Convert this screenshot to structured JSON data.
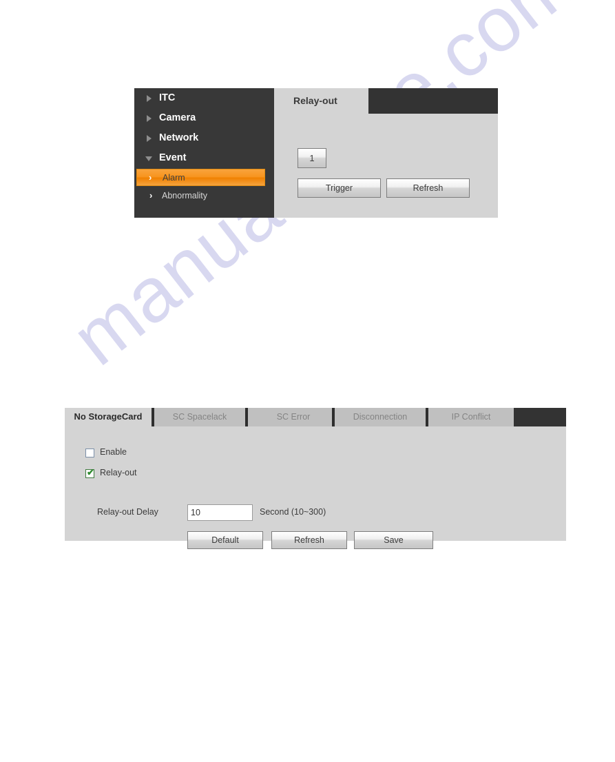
{
  "watermark": {
    "text": "manualshive.com"
  },
  "relay_panel": {
    "sidebar": {
      "top_items": [
        {
          "label": "ITC",
          "icon": "triangle-right-icon",
          "expanded": false
        },
        {
          "label": "Camera",
          "icon": "triangle-right-icon",
          "expanded": false
        },
        {
          "label": "Network",
          "icon": "triangle-right-icon",
          "expanded": false
        },
        {
          "label": "Event",
          "icon": "triangle-down-icon",
          "expanded": true
        }
      ],
      "sub_items": [
        {
          "label": "Alarm",
          "icon": "chevron-right-icon",
          "active": true
        },
        {
          "label": "Abnormality",
          "icon": "chevron-right-icon",
          "active": false
        }
      ]
    },
    "tab": {
      "label": "Relay-out"
    },
    "channel_button": {
      "label": "1"
    },
    "trigger_button": {
      "label": "Trigger"
    },
    "refresh_button": {
      "label": "Refresh"
    }
  },
  "abnormality_panel": {
    "tabs": [
      {
        "label": "No StorageCard",
        "active": true
      },
      {
        "label": "SC Spacelack",
        "active": false
      },
      {
        "label": "SC Error",
        "active": false
      },
      {
        "label": "Disconnection",
        "active": false
      },
      {
        "label": "IP Conflict",
        "active": false
      }
    ],
    "enable_checkbox": {
      "label": "Enable",
      "checked": false
    },
    "relay_out_checkbox": {
      "label": "Relay-out",
      "checked": true,
      "mark": "✔"
    },
    "delay_field": {
      "label": "Relay-out Delay",
      "value": "10",
      "placeholder": "10",
      "unit": "Second (10~300)"
    },
    "default_button": {
      "label": "Default"
    },
    "refresh_button": {
      "label": "Refresh"
    },
    "save_button": {
      "label": "Save"
    }
  },
  "colors": {
    "accent_orange": "#f7941e",
    "panel_gray": "#d4d4d4",
    "dark_chrome": "#333333",
    "watermark": "#b9b9e4"
  }
}
